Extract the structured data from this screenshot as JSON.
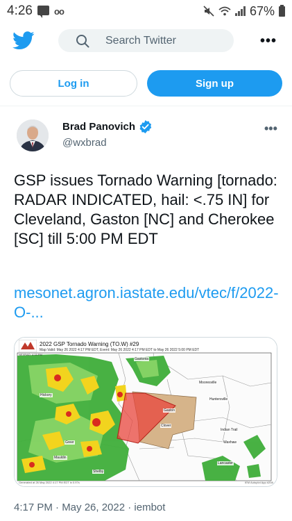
{
  "status_bar": {
    "time": "4:26",
    "voicemail": "oo",
    "battery_percent": "67%",
    "icons": [
      "message-icon",
      "voicemail-icon",
      "mute-icon",
      "wifi-icon",
      "signal-icon",
      "battery-icon"
    ]
  },
  "header": {
    "logo": "twitter-bird-icon",
    "search_placeholder": "Search Twitter",
    "more_label": "•••"
  },
  "auth": {
    "login_label": "Log in",
    "signup_label": "Sign up"
  },
  "tweet": {
    "author_name": "Brad Panovich",
    "author_handle": "@wxbrad",
    "more_label": "•••",
    "text": "GSP issues Tornado Warning [tornado: RADAR INDICATED, hail: <.75 IN] for Cleveland, Gaston [NC] and Cherokee [SC] till 5:00 PM EDT",
    "link": "mesonet.agron.iastate.edu/vtec/f/2022-O-...",
    "timestamp": "4:17 PM · May 26, 2022 · iembot"
  },
  "media": {
    "title": "2022 GSP Tornado Warning (TO.W) #29",
    "subtitle": "Map Valid: May 26 2022 4:17 PM EDT, Event: May 26 2022 4:17 PM EDT to May 26 2022 5:00 PM EDT",
    "nexrad": "NEXRAD: 4:15 PM",
    "footer_left": "Generated at 26 May 2022 4:17 PM EDT in 0.97s",
    "footer_right": "IEM Autoplot App #208",
    "cities": [
      "Hickory",
      "Gastonia",
      "Mooresville",
      "Huntersville",
      "Gaston",
      "Clover",
      "Indian Trail",
      "Waxhaw",
      "Lancaster",
      "Shelby",
      "Greer",
      "Mauldin"
    ],
    "colors": {
      "warning_polygon": "#e8463c",
      "county_fill": "#d6b48a",
      "radar_green": "#3fae3a",
      "radar_yellow": "#f2d41e",
      "radar_red": "#d92b1f"
    }
  },
  "theme": {
    "accent": "#1d9bf0",
    "text": "#0f1419",
    "muted": "#536471"
  }
}
